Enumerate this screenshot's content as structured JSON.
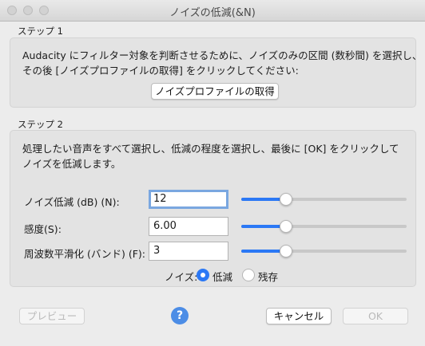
{
  "window": {
    "title": "ノイズの低減(&N)"
  },
  "step1": {
    "label": "ステップ 1",
    "line1": "Audacity にフィルター対象を判断させるために、ノイズのみの区間 (数秒間) を選択し、",
    "line2": "その後 [ノイズプロファイルの取得] をクリックしてください:",
    "button": "ノイズプロファイルの取得"
  },
  "step2": {
    "label": "ステップ 2",
    "line1": "処理したい音声をすべて選択し、低減の程度を選択し、最後に [OK] をクリックして",
    "line2": "ノイズを低減します。",
    "params": [
      {
        "label": "ノイズ低減 (dB) (N):",
        "value": "12",
        "slider": 0.27
      },
      {
        "label": "感度(S):",
        "value": "6.00",
        "slider": 0.27
      },
      {
        "label": "周波数平滑化 (バンド) (F):",
        "value": "3",
        "slider": 0.27
      }
    ],
    "noise_label": "ノイズ:",
    "radio_reduce": "低減",
    "radio_residue": "残存",
    "selected": "低減"
  },
  "buttons": {
    "preview": "プレビュー",
    "help": "?",
    "cancel": "キャンセル",
    "ok": "OK"
  },
  "colors": {
    "accent": "#2b78f5",
    "help": "#4c8de6"
  }
}
